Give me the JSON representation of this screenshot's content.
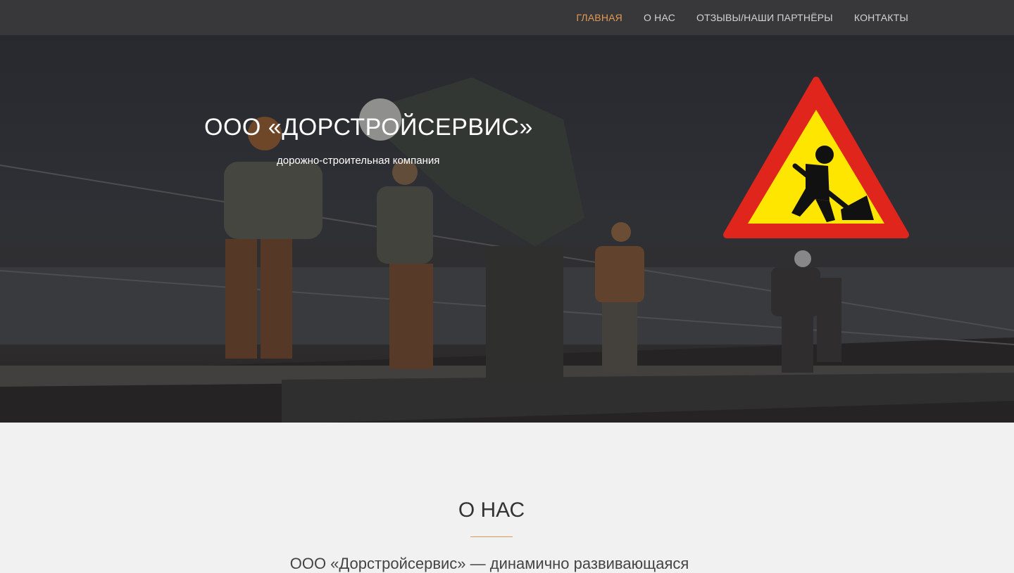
{
  "nav": {
    "items": [
      {
        "label": "ГЛАВНАЯ",
        "active": true
      },
      {
        "label": "О НАС",
        "active": false
      },
      {
        "label": "ОТЗЫВЫ/НАШИ ПАРТНЁРЫ",
        "active": false
      },
      {
        "label": "КОНТАКТЫ",
        "active": false
      }
    ]
  },
  "hero": {
    "title": "ООО «ДОРСТРОЙСЕРВИС»",
    "subtitle": "дорожно-строительная компания",
    "sign_icon": "road-works-warning-sign"
  },
  "about": {
    "heading": "О НАС",
    "text": "ООО «Дорстройсервис» — динамично развивающаяся"
  },
  "colors": {
    "accent": "#e09955",
    "navbar_bg": "#38383a",
    "page_bg": "#f1f1f1",
    "sign_border": "#e0261c",
    "sign_fill": "#ffe600"
  }
}
